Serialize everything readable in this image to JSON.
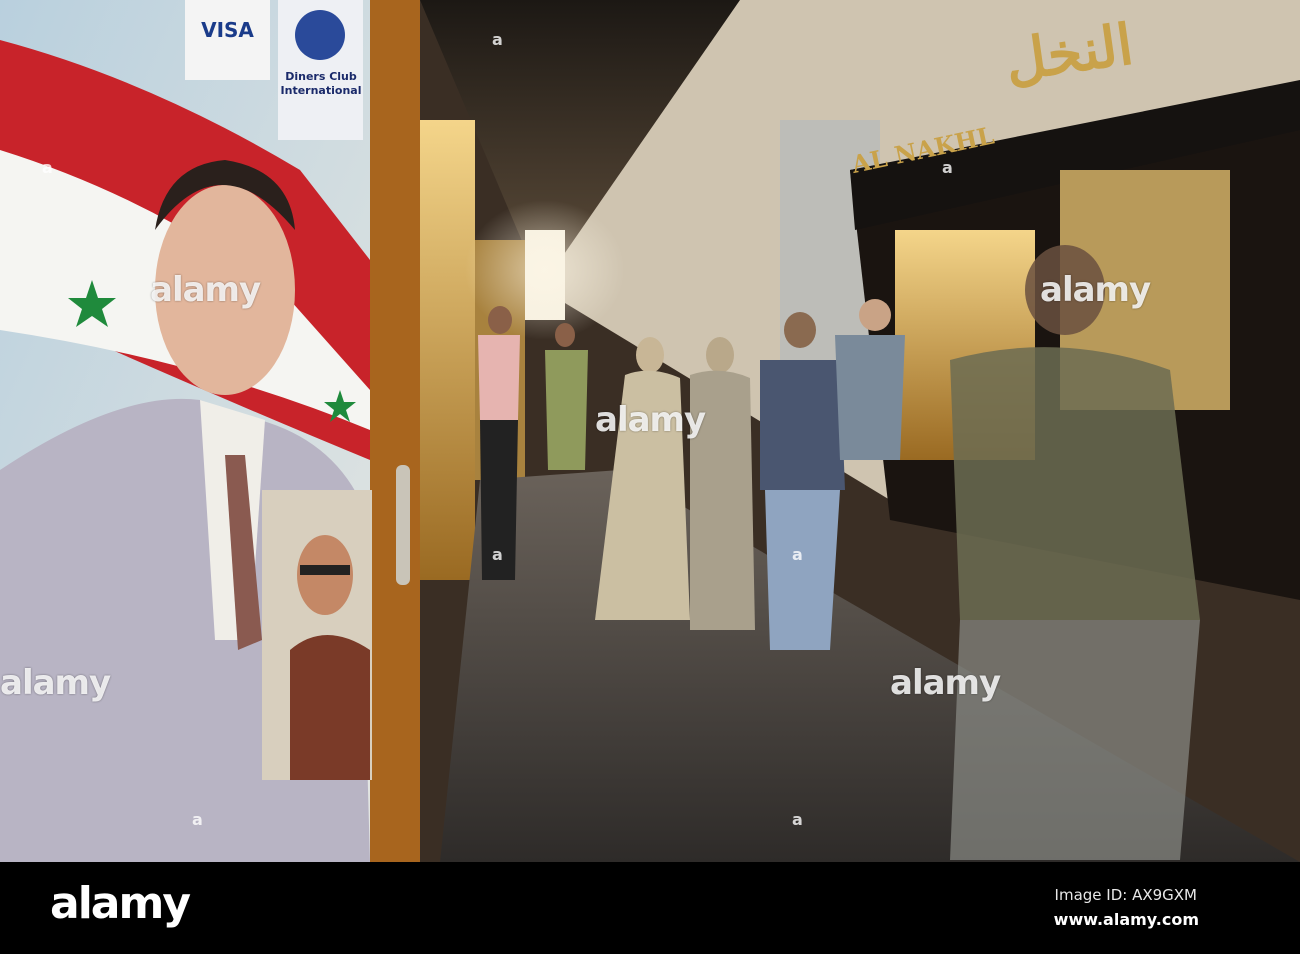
{
  "watermark": {
    "text": "alamy",
    "dot": "a"
  },
  "signs": {
    "shop_name_latin": "AL NAKHL",
    "shop_name_arabic": "النخل",
    "card_visa": "VISA",
    "card_diners": "Diners Club International"
  },
  "footer": {
    "logo": "alamy",
    "image_id": "Image ID: AX9GXM",
    "url": "www.alamy.com"
  }
}
